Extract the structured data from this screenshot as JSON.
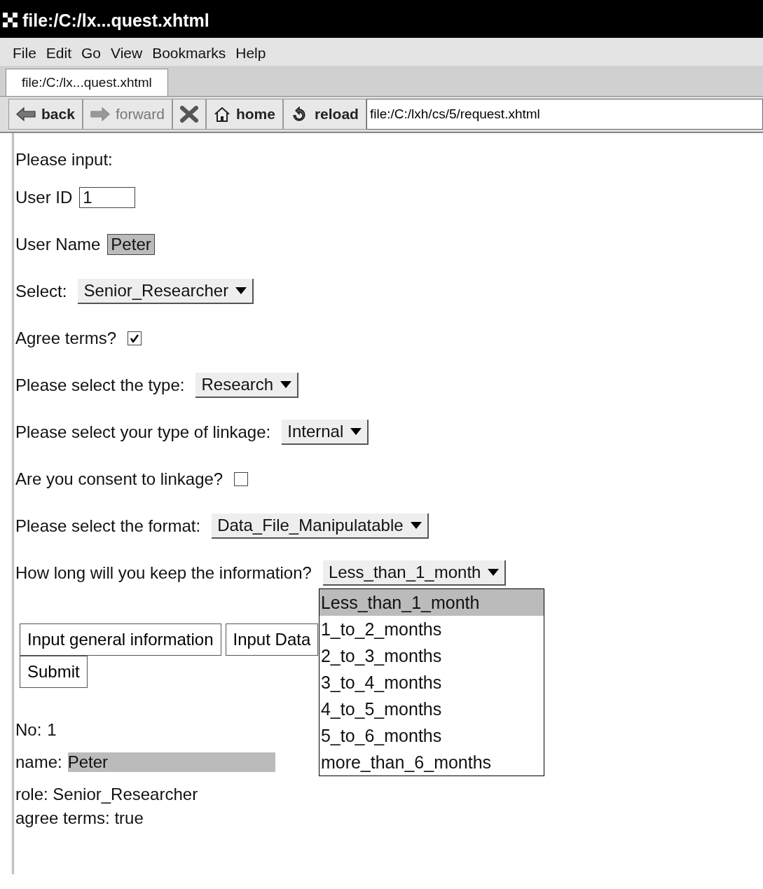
{
  "window": {
    "title": "file:/C:/lx...quest.xhtml"
  },
  "menu": [
    "File",
    "Edit",
    "Go",
    "View",
    "Bookmarks",
    "Help"
  ],
  "tabs": [
    {
      "label": "file:/C:/lx...quest.xhtml"
    }
  ],
  "toolbar": [
    {
      "kind": "back",
      "label": "back",
      "disabled": false
    },
    {
      "kind": "forward",
      "label": "forward",
      "disabled": true
    },
    {
      "kind": "stop",
      "disabled": false
    },
    {
      "kind": "home",
      "label": "home",
      "disabled": false
    },
    {
      "kind": "reload",
      "label": "reload",
      "disabled": false
    }
  ],
  "address": {
    "value": "file:/C:/lxh/cs/5/request.xhtml"
  },
  "form": [
    {
      "kind": "heading",
      "label": "Please input:"
    },
    {
      "kind": "input",
      "label": "User ID",
      "value": "1",
      "highlighted": false
    },
    {
      "kind": "input",
      "label": "User Name",
      "value": "Peter",
      "highlighted": true
    },
    {
      "kind": "select",
      "label": "Select:",
      "value": "Senior_Researcher"
    },
    {
      "kind": "checkbox",
      "label": "Agree terms?",
      "checked": true
    },
    {
      "kind": "select",
      "label": "Please select the type:",
      "value": "Research"
    },
    {
      "kind": "select",
      "label": "Please select your type of linkage:",
      "value": "Internal"
    },
    {
      "kind": "checkbox",
      "label": "Are you consent to linkage?",
      "checked": false
    },
    {
      "kind": "select",
      "label": "Please select the format:",
      "value": "Data_File_Manipulatable"
    },
    {
      "kind": "select",
      "label": "How long will you keep the information?",
      "value": "Less_than_1_month",
      "options": [
        {
          "label": "Less_than_1_month",
          "selected": true
        },
        {
          "label": "1_to_2_months",
          "selected": false
        },
        {
          "label": "2_to_3_months",
          "selected": false
        },
        {
          "label": "3_to_4_months",
          "selected": false
        },
        {
          "label": "4_to_5_months",
          "selected": false
        },
        {
          "label": "5_to_6_months",
          "selected": false
        },
        {
          "label": "more_than_6_months",
          "selected": false
        }
      ]
    }
  ],
  "buttons": [
    [
      "Input general information",
      "Input Data"
    ],
    [
      "Submit"
    ]
  ],
  "output": [
    {
      "label": "No:",
      "value": "1",
      "highlighted": false
    },
    {
      "label": "name:",
      "value": "Peter",
      "highlighted": true
    }
  ],
  "output_plain": [
    "role: Senior_Researcher",
    "agree terms: true"
  ]
}
